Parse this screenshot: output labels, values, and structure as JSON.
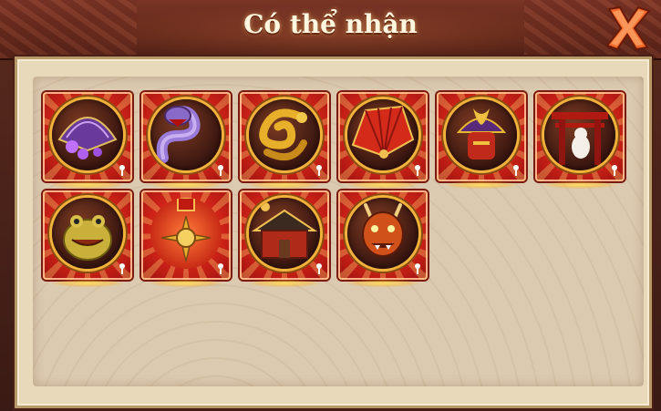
{
  "dialog": {
    "title": "Có thể nhận",
    "close_icon": "close-x-icon",
    "accent_color": "#d9261a",
    "frame_color": "#e9d9bb"
  },
  "items": [
    {
      "name": "purple-fan",
      "icon": "purple-fan-icon"
    },
    {
      "name": "purple-serpent",
      "icon": "serpent-icon"
    },
    {
      "name": "golden-dragon",
      "icon": "golden-dragon-icon"
    },
    {
      "name": "red-war-fan",
      "icon": "red-war-fan-icon"
    },
    {
      "name": "samurai-helmet",
      "icon": "samurai-helmet-icon"
    },
    {
      "name": "torii-gate",
      "icon": "torii-gate-icon"
    },
    {
      "name": "gama-toad",
      "icon": "toad-icon"
    },
    {
      "name": "sun-emblem",
      "icon": "sun-emblem-icon"
    },
    {
      "name": "red-shrine",
      "icon": "shrine-icon"
    },
    {
      "name": "oni-demon",
      "icon": "oni-demon-icon"
    }
  ]
}
